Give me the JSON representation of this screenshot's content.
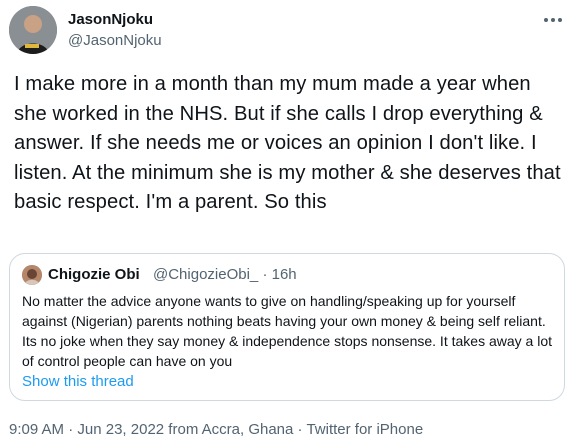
{
  "author": {
    "name": "JasonNjoku",
    "handle": "@JasonNjoku",
    "avatar_icon": "user-avatar"
  },
  "tweet": {
    "text": "I make more in a month than my mum made a year when she worked in the NHS. But if she calls I drop everything & answer. If she needs me or voices an opinion I don't like. I listen. At the minimum she is my mother & she deserves that basic respect. I'm a parent. So this",
    "more_icon": "more-options-icon"
  },
  "quoted_tweet": {
    "name": "Chigozie Obi",
    "handle": "@ChigozieObi_",
    "separator": "·",
    "time": "16h",
    "text": "No matter the advice anyone wants to give on handling/speaking up for yourself against (Nigerian) parents nothing beats having your own money & being self reliant. Its no joke when they say money & independence stops nonsense. It takes away a lot of control people can have on you",
    "show_thread": "Show this thread"
  },
  "meta": {
    "time": "9:09 AM",
    "sep1": " · ",
    "date": "Jun 23, 2022",
    "location_prefix": " from ",
    "location": "Accra, Ghana",
    "sep2": " · ",
    "client": "Twitter for iPhone"
  },
  "colors": {
    "text": "#0f1419",
    "secondary": "#536471",
    "link": "#1d9bf0",
    "border": "#cfd9de"
  }
}
